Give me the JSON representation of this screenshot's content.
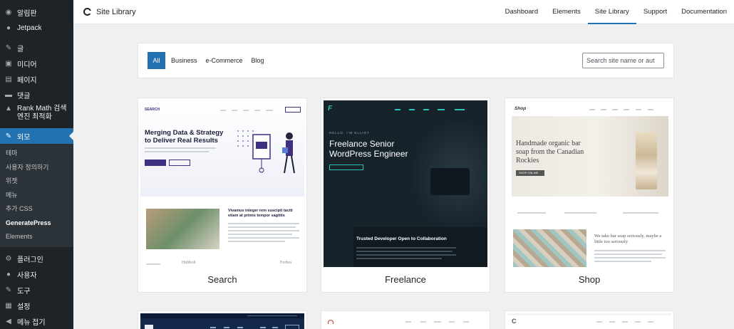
{
  "sidebar": {
    "items": [
      {
        "icon": "dashboard-icon",
        "glyph": "◉",
        "label": "알림판"
      },
      {
        "icon": "jetpack-icon",
        "glyph": "●",
        "label": "Jetpack"
      },
      {
        "icon": "pin-icon",
        "glyph": "✎",
        "label": "글"
      },
      {
        "icon": "media-icon",
        "glyph": "▣",
        "label": "미디어"
      },
      {
        "icon": "page-icon",
        "glyph": "▤",
        "label": "페이지"
      },
      {
        "icon": "comment-icon",
        "glyph": "▬",
        "label": "댓글"
      },
      {
        "icon": "rank-math-icon",
        "glyph": "▲",
        "label": "Rank Math 검색엔진 최적화"
      },
      {
        "icon": "appearance-icon",
        "glyph": "✎",
        "label": "외모"
      }
    ],
    "submenu": [
      "테마",
      "사용자 정의하기",
      "위젯",
      "메뉴",
      "추가 CSS",
      "GeneratePress",
      "Elements"
    ],
    "bottom_items": [
      {
        "icon": "plugin-icon",
        "glyph": "⚙",
        "label": "플러그인"
      },
      {
        "icon": "users-icon",
        "glyph": "●",
        "label": "사용자"
      },
      {
        "icon": "tools-icon",
        "glyph": "✎",
        "label": "도구"
      },
      {
        "icon": "settings-icon",
        "glyph": "▦",
        "label": "설정"
      },
      {
        "icon": "collapse-icon",
        "glyph": "◀",
        "label": "메뉴 접기"
      }
    ]
  },
  "header": {
    "title": "Site Library",
    "nav": [
      "Dashboard",
      "Elements",
      "Site Library",
      "Support",
      "Documentation"
    ],
    "active_nav": "Site Library"
  },
  "filters": {
    "tabs": [
      "All",
      "Business",
      "e-Commerce",
      "Blog"
    ],
    "active": "All",
    "search_value": "Search site name or aut"
  },
  "sites": [
    {
      "name": "Search",
      "thumb": {
        "logo": "SEARCH",
        "headline": "Merging Data & Strategy to Deliver Real Results",
        "sub_heading": "Vivamus integer non suscipit taciti etiam at primis tempor sagittis",
        "logos": [
          "Hubbolt",
          "Forbes"
        ]
      }
    },
    {
      "name": "Freelance",
      "thumb": {
        "tagline": "HELLO, I'M ELLIOT",
        "headline": "Freelance Senior WordPress Engineer",
        "caption": "Trusted Developer Open to Collaboration"
      }
    },
    {
      "name": "Shop",
      "thumb": {
        "logo": "Shop",
        "headline": "Handmade organic bar soap from the Canadian Rockies",
        "button": "SHOP ONLINE",
        "text": "We take bar soap seriously, maybe a little too seriously"
      }
    }
  ],
  "colors": {
    "accent": "#2271b1",
    "sidebar_bg": "#1d2327",
    "freelance_bg": "#16232b",
    "freelance_accent": "#2bc1b6",
    "search_accent": "#3e2f80"
  }
}
